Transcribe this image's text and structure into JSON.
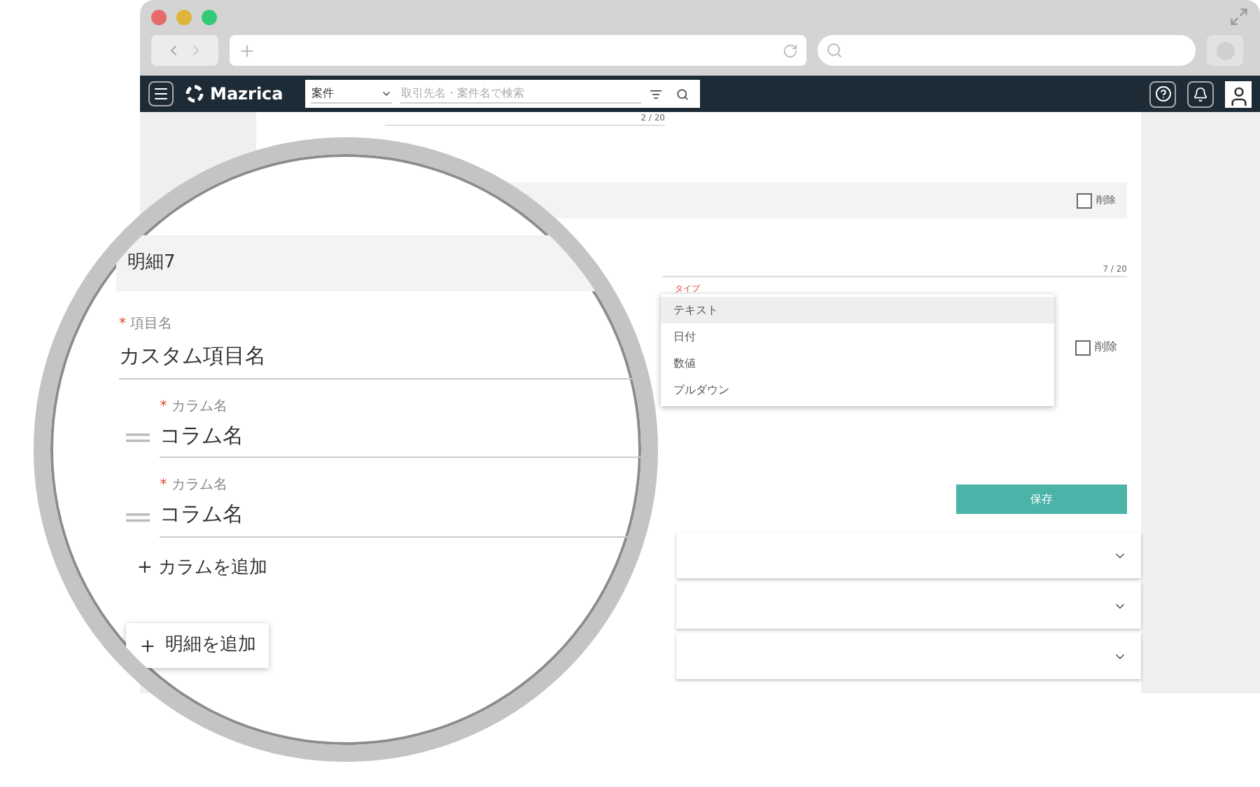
{
  "app_bar": {
    "logo": "Mazrica",
    "search_scope": "案件",
    "search_placeholder": "取引先名・案件名で検索"
  },
  "form": {
    "counter_top": "2 / 20",
    "section_delete": {
      "label": "削除",
      "checked": false
    },
    "counter_name": "7 / 20",
    "type_label": "タイプ",
    "type_options": [
      {
        "label": "テキスト",
        "selected": true
      },
      {
        "label": "日付",
        "selected": false
      },
      {
        "label": "数値",
        "selected": false
      },
      {
        "label": "プルダウン",
        "selected": false
      }
    ],
    "column_delete": {
      "label": "削除",
      "checked": false
    },
    "save_button": "保存",
    "collapsed_panels": [
      {
        "expanded": false
      },
      {
        "expanded": false
      },
      {
        "expanded": false
      }
    ]
  },
  "magnifier": {
    "section_title": "明細7",
    "item_required_mark": "*",
    "item_label": "項目名",
    "item_value": "カスタム項目名",
    "columns": [
      {
        "required_mark": "*",
        "label": "カラム名",
        "value": "コラム名"
      },
      {
        "required_mark": "*",
        "label": "カラム名",
        "value": "コラム名"
      }
    ],
    "add_column": "+ カラムを追加",
    "add_detail": "明細を追加"
  }
}
